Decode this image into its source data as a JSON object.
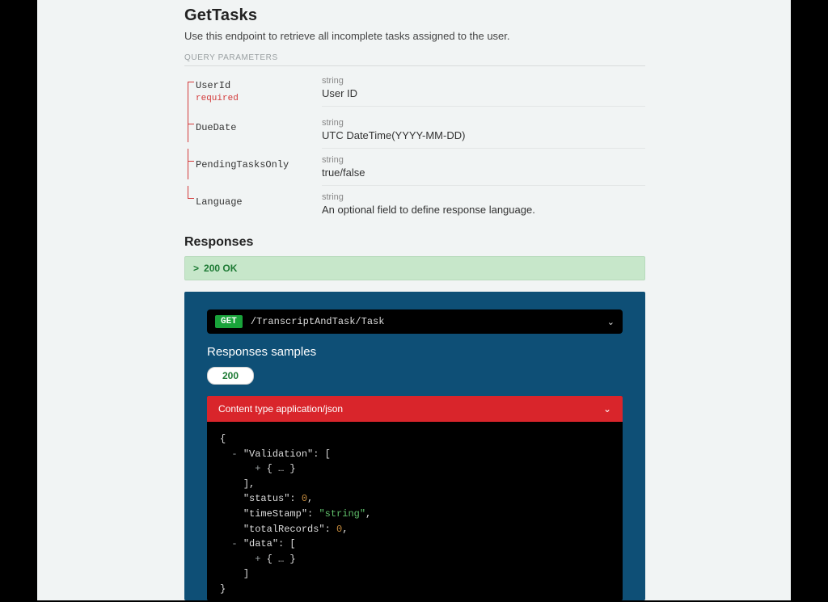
{
  "title": "GetTasks",
  "description": "Use this endpoint to retrieve all incomplete tasks assigned to the user.",
  "sectionLabel": "QUERY PARAMETERS",
  "params": [
    {
      "name": "UserId",
      "required": "required",
      "type": "string",
      "desc": "User ID"
    },
    {
      "name": "DueDate",
      "required": "",
      "type": "string",
      "desc": "UTC DateTime(YYYY-MM-DD)"
    },
    {
      "name": "PendingTasksOnly",
      "required": "",
      "type": "string",
      "desc": "true/false"
    },
    {
      "name": "Language",
      "required": "",
      "type": "string",
      "desc": "An optional field to define response language."
    }
  ],
  "responsesHeading": "Responses",
  "respBanner": {
    "chev": ">",
    "label": "200 OK"
  },
  "request": {
    "method": "GET",
    "path": "/TranscriptAndTask/Task"
  },
  "samplesTitle": "Responses samples",
  "pill": "200",
  "contentTypeLabel": "Content type application/json",
  "json": {
    "l1": "{",
    "l2a": "- ",
    "l2k": "\"Validation\"",
    "l2b": ": [",
    "l3a": "+ ",
    "l3b": "{ … }",
    "l4": "],",
    "l5k": "\"status\"",
    "l5v": "0",
    "l5c": ",",
    "l6k": "\"timeStamp\"",
    "l6v": "\"string\"",
    "l6c": ",",
    "l7k": "\"totalRecords\"",
    "l7v": "0",
    "l7c": ",",
    "l8a": "- ",
    "l8k": "\"data\"",
    "l8b": ": [",
    "l9a": "+ ",
    "l9b": "{ … }",
    "l10": "]",
    "l11": "}"
  }
}
